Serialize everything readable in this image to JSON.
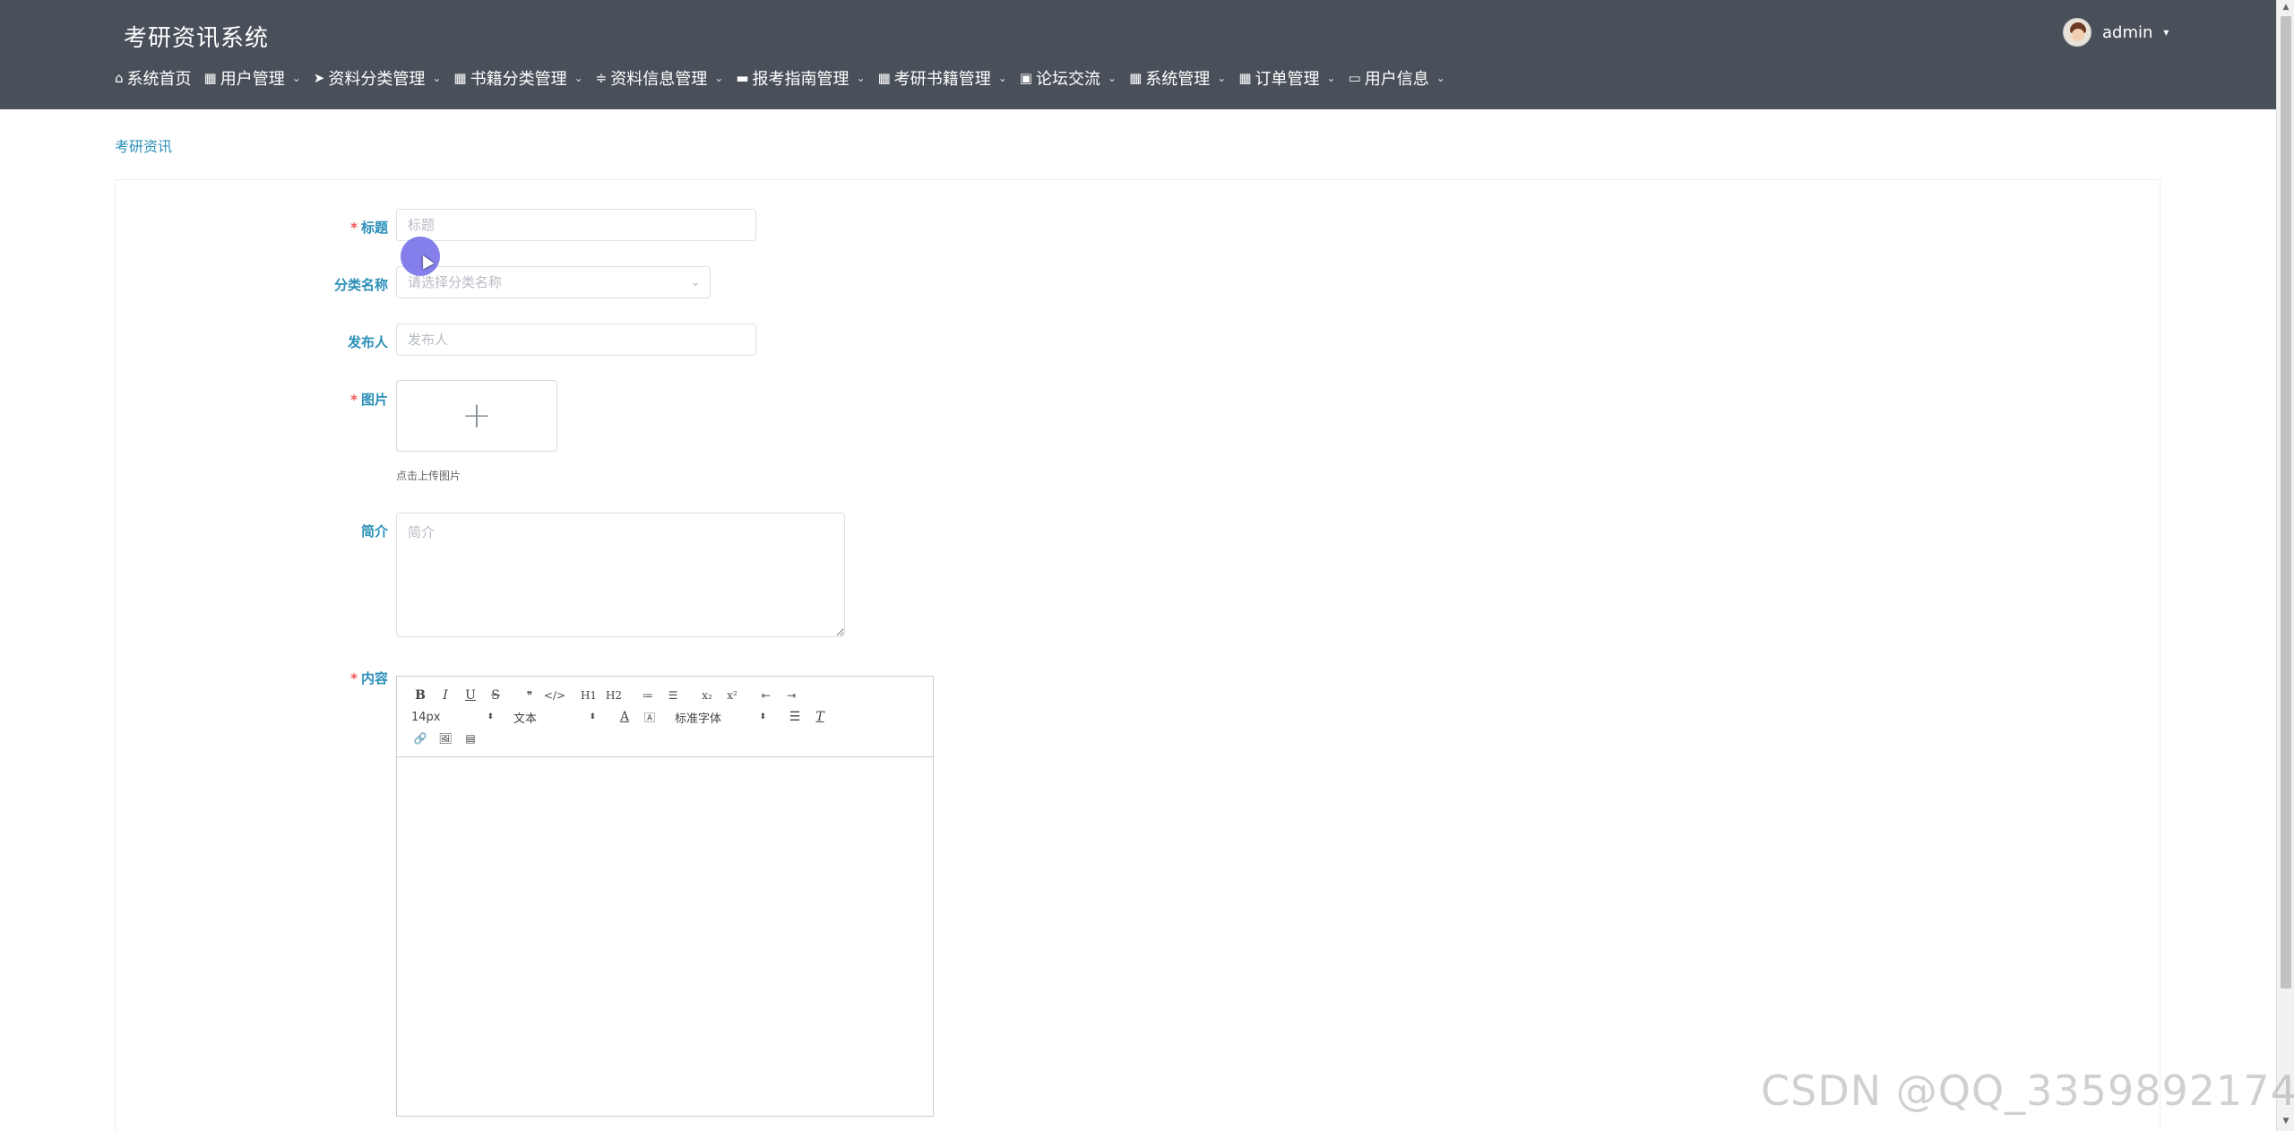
{
  "header": {
    "app_title": "考研资讯系统",
    "user_name": "admin",
    "user_caret": "▾"
  },
  "nav": {
    "items": [
      {
        "label": "系统首页",
        "icon": "home-icon",
        "glyph": "⌂",
        "has_dropdown": false
      },
      {
        "label": "用户管理",
        "icon": "grid-icon",
        "glyph": "▦",
        "has_dropdown": true
      },
      {
        "label": "资料分类管理",
        "icon": "send-icon",
        "glyph": "➤",
        "has_dropdown": true
      },
      {
        "label": "书籍分类管理",
        "icon": "grid-icon",
        "glyph": "▦",
        "has_dropdown": true
      },
      {
        "label": "资料信息管理",
        "icon": "sliders-icon",
        "glyph": "≑",
        "has_dropdown": true
      },
      {
        "label": "报考指南管理",
        "icon": "chat-icon",
        "glyph": "▬",
        "has_dropdown": true
      },
      {
        "label": "考研书籍管理",
        "icon": "grid-icon",
        "glyph": "▦",
        "has_dropdown": true
      },
      {
        "label": "论坛交流",
        "icon": "image-icon",
        "glyph": "▣",
        "has_dropdown": true
      },
      {
        "label": "系统管理",
        "icon": "grid-icon",
        "glyph": "▦",
        "has_dropdown": true
      },
      {
        "label": "订单管理",
        "icon": "grid-icon",
        "glyph": "▦",
        "has_dropdown": true
      },
      {
        "label": "用户信息",
        "icon": "card-icon",
        "glyph": "▭",
        "has_dropdown": true
      }
    ],
    "chevron": "⌄"
  },
  "breadcrumb": "考研资讯",
  "form": {
    "title_label": "标题",
    "title_placeholder": "标题",
    "category_label": "分类名称",
    "category_placeholder": "请选择分类名称",
    "publisher_label": "发布人",
    "publisher_placeholder": "发布人",
    "image_label": "图片",
    "upload_tip": "点击上传图片",
    "intro_label": "简介",
    "intro_placeholder": "简介",
    "content_label": "内容",
    "required_mark": "*"
  },
  "editor": {
    "row1": [
      "B",
      "I",
      "U",
      "S",
      "❞",
      "</>",
      "H1",
      "H2",
      "≔",
      "☰",
      "x₂",
      "x²",
      "⇤",
      "⇥"
    ],
    "font_size": "14px",
    "header_select": "文本",
    "font_family": "标准字体",
    "row3": [
      "🔗",
      "🖼",
      "▤"
    ]
  },
  "watermark": "CSDN @QQ_3359892174",
  "colors": {
    "header_bg": "#4a505a",
    "accent": "#2b8fb8",
    "required": "#f25656"
  }
}
